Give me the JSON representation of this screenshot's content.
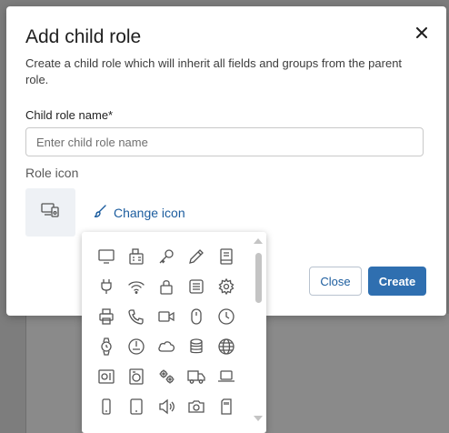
{
  "dialog": {
    "title": "Add child role",
    "subtitle": "Create a child role which will inherit all fields and groups from the parent role.",
    "field_label": "Child role name*",
    "field_value": "",
    "field_placeholder": "Enter child role name",
    "icon_section_label": "Role icon",
    "selected_icon": "devices-icon",
    "change_icon_label": "Change icon",
    "close_label": "Close",
    "create_label": "Create",
    "accent_color": "#2f6fb0"
  },
  "icon_picker": {
    "icons": [
      "monitor-icon",
      "fax-icon",
      "key-icon",
      "pencil-icon",
      "book-icon",
      "plug-icon",
      "wifi-icon",
      "lock-icon",
      "server-icon",
      "gear-icon",
      "printer-icon",
      "phone-icon",
      "video-camera-icon",
      "mouse-icon",
      "clock-icon",
      "watch-icon",
      "gauge-icon",
      "cloud-icon",
      "database-icon",
      "globe-icon",
      "safe-icon",
      "washing-machine-icon",
      "gears-icon",
      "truck-icon",
      "laptop-icon",
      "phone-device-icon",
      "tablet-icon",
      "speaker-icon",
      "camera-icon",
      "sd-card-icon"
    ]
  }
}
